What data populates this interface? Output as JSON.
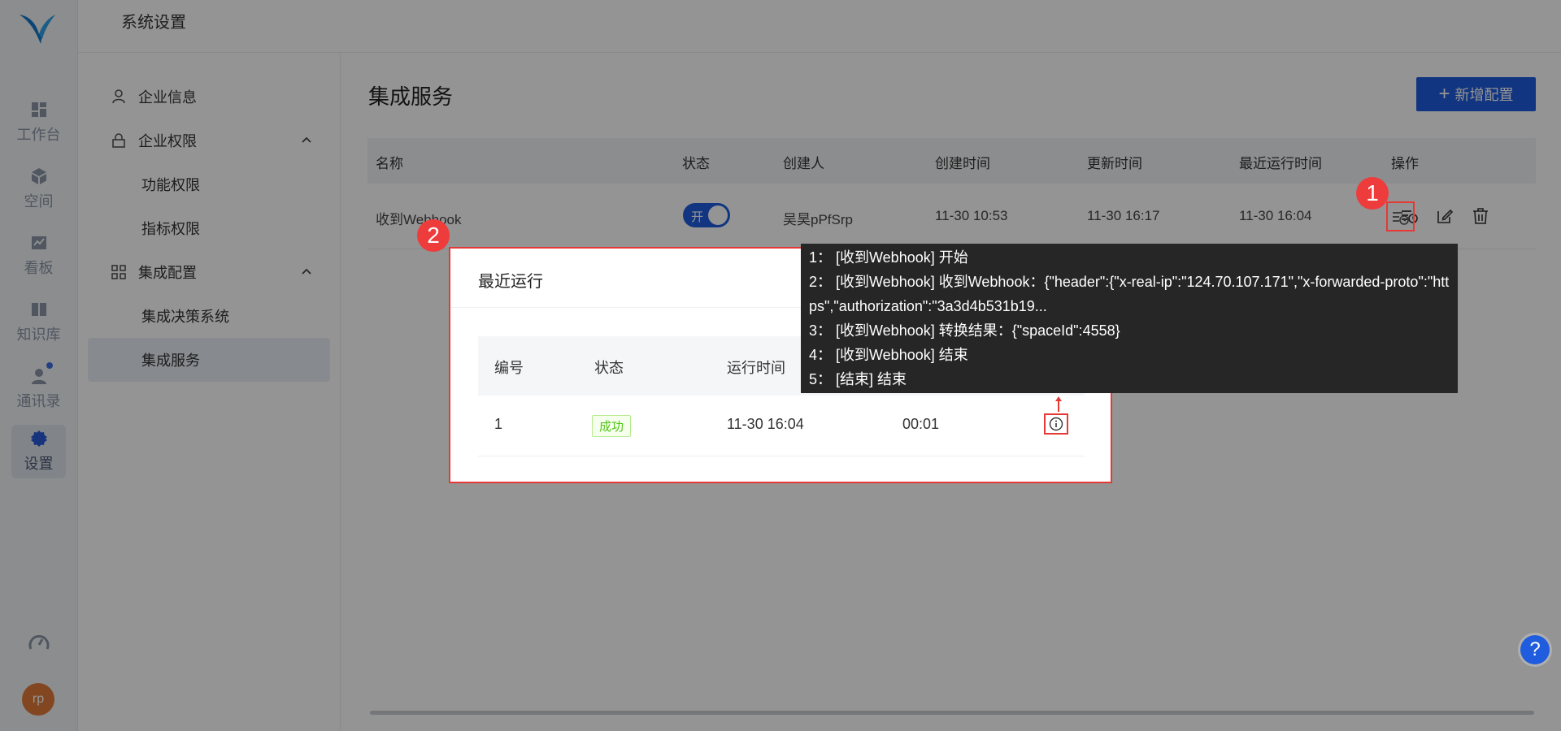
{
  "header": {
    "title": "系统设置"
  },
  "rail": {
    "items": [
      {
        "label": "工作台",
        "icon": "dashboard-icon"
      },
      {
        "label": "空间",
        "icon": "cube-icon"
      },
      {
        "label": "看板",
        "icon": "chart-board-icon"
      },
      {
        "label": "知识库",
        "icon": "book-icon"
      },
      {
        "label": "通讯录",
        "icon": "contacts-icon"
      },
      {
        "label": "设置",
        "icon": "gear-icon"
      }
    ],
    "avatar_initials": "rp"
  },
  "subnav": {
    "enterprise_info": "企业信息",
    "permissions": "企业权限",
    "feature_permissions": "功能权限",
    "metric_permissions": "指标权限",
    "integration_config": "集成配置",
    "integration_decision": "集成决策系统",
    "integration_service": "集成服务"
  },
  "main": {
    "title": "集成服务",
    "add_button": "新增配置",
    "columns": [
      "名称",
      "状态",
      "创建人",
      "创建时间",
      "更新时间",
      "最近运行时间",
      "操作"
    ],
    "row": {
      "name": "收到Webhook",
      "status_toggle": "开",
      "creator": "吴昊pPfSrp",
      "created": "11-30 10:53",
      "updated": "11-30 16:17",
      "last_run": "11-30 16:04"
    }
  },
  "modal": {
    "title": "最近运行",
    "columns": [
      "编号",
      "状态",
      "运行时间"
    ],
    "row": {
      "id": "1",
      "status": "成功",
      "run_time": "11-30 16:04",
      "duration": "00:01"
    }
  },
  "tooltip": {
    "lines": [
      "1： [收到Webhook] 开始",
      "2： [收到Webhook] 收到Webhook：{\"header\":{\"x-real-ip\":\"124.70.107.171\",\"x-forwarded-proto\":\"https\",\"authorization\":\"3a3d4b531b19...",
      "3： [收到Webhook] 转换结果：{\"spaceId\":4558}",
      "4： [收到Webhook] 结束",
      "5： [结束] 结束"
    ]
  },
  "markers": {
    "one": "1",
    "two": "2"
  },
  "help": "?",
  "colors": {
    "primary": "#1f5cde",
    "highlight": "#e53935",
    "success": "#52c41a"
  }
}
